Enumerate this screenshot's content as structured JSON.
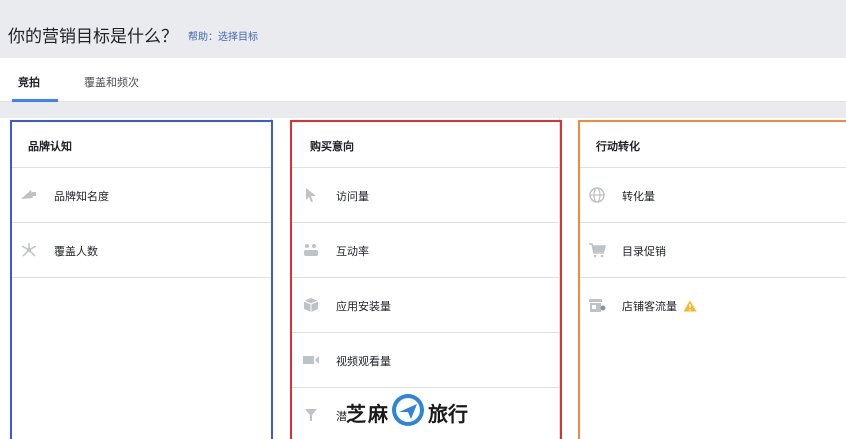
{
  "header": {
    "title": "你的营销目标是什么？",
    "help": "帮助：选择目标"
  },
  "tabs": [
    {
      "label": "竞拍",
      "active": true
    },
    {
      "label": "覆盖和频次",
      "active": false
    }
  ],
  "columns": [
    {
      "title": "品牌认知",
      "options": [
        {
          "label": "品牌知名度",
          "icon": "megaphone-icon"
        },
        {
          "label": "覆盖人数",
          "icon": "reach-icon"
        }
      ]
    },
    {
      "title": "购买意向",
      "options": [
        {
          "label": "访问量",
          "icon": "cursor-icon"
        },
        {
          "label": "互动率",
          "icon": "engagement-icon"
        },
        {
          "label": "应用安装量",
          "icon": "app-box-icon"
        },
        {
          "label": "视频观看量",
          "icon": "video-camera-icon"
        },
        {
          "label": "潜",
          "icon": "filter-icon"
        }
      ]
    },
    {
      "title": "行动转化",
      "options": [
        {
          "label": "转化量",
          "icon": "globe-icon"
        },
        {
          "label": "目录促销",
          "icon": "cart-icon"
        },
        {
          "label": "店铺客流量",
          "icon": "store-icon",
          "warning": true
        }
      ]
    }
  ],
  "watermark": {
    "left": "芝",
    "middle": "麻",
    "right": "旅行"
  },
  "colors": {
    "icon_grey": "#bec2c9",
    "tab_accent": "#4080ff",
    "warning": "#f7b928",
    "frame_blue": "#3a5bd9",
    "frame_red": "#e03131",
    "frame_orange": "#f08a3c"
  }
}
